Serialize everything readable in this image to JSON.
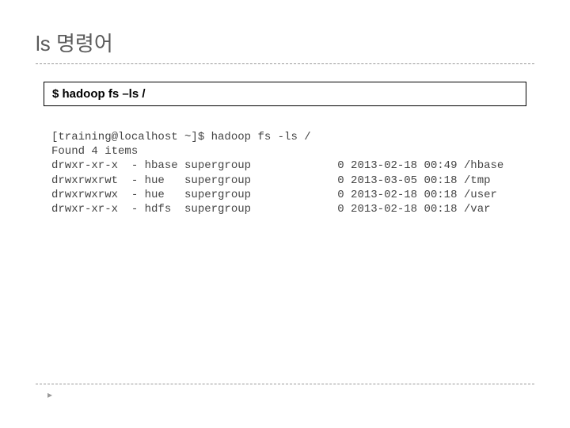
{
  "title": "ls 명령어",
  "command": "$ hadoop fs –ls /",
  "terminal": {
    "prompt": "[training@localhost ~]$ hadoop fs -ls /",
    "found_line": "Found 4 items",
    "rows": [
      {
        "perms": "drwxr-xr-x",
        "dash": "-",
        "owner": "hbase",
        "group": "supergroup",
        "size": "0",
        "date": "2013-02-18 00:49",
        "path": "/hbase"
      },
      {
        "perms": "drwxrwxrwt",
        "dash": "-",
        "owner": "hue",
        "group": "supergroup",
        "size": "0",
        "date": "2013-03-05 00:18",
        "path": "/tmp"
      },
      {
        "perms": "drwxrwxrwx",
        "dash": "-",
        "owner": "hue",
        "group": "supergroup",
        "size": "0",
        "date": "2013-02-18 00:18",
        "path": "/user"
      },
      {
        "perms": "drwxr-xr-x",
        "dash": "-",
        "owner": "hdfs",
        "group": "supergroup",
        "size": "0",
        "date": "2013-02-18 00:18",
        "path": "/var"
      }
    ]
  },
  "footer_marker": "▸"
}
